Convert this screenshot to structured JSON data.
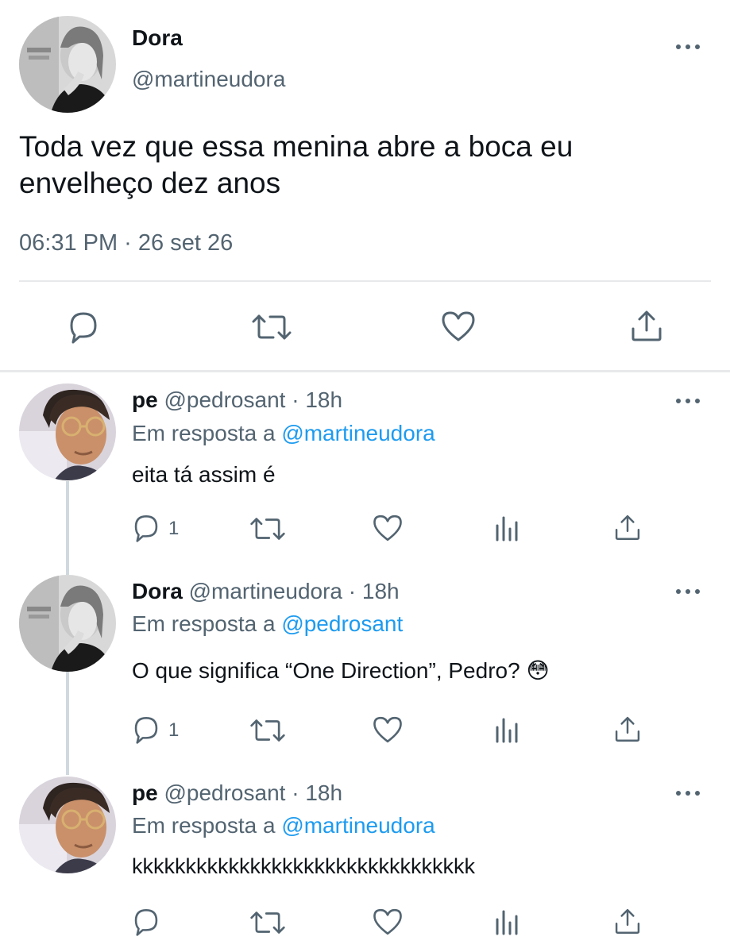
{
  "main_tweet": {
    "name": "Dora",
    "handle": "@martineudora",
    "text_line1": "Toda vez que essa menina abre a boca eu",
    "text_line2": "envelheço dez anos",
    "timestamp": "06:31 PM · 26 set 26",
    "actions": [
      "reply-icon",
      "retweet-icon",
      "like-icon",
      "share-icon"
    ]
  },
  "replies": [
    {
      "name": "pe",
      "handle": "@pedrosant",
      "time": "· 18h",
      "reply_label": "Em resposta a",
      "reply_to": "@martineudora",
      "text": "eita tá assim é",
      "reply_count": "1"
    },
    {
      "name": "Dora",
      "handle": "@martineudora",
      "time": "· 18h",
      "reply_label": "Em resposta a",
      "reply_to": "@pedrosant",
      "text": "O que significa “One Direction”, Pedro? 😳",
      "reply_count": "1"
    },
    {
      "name": "pe",
      "handle": "@pedrosant",
      "time": "· 18h",
      "reply_label": "Em resposta a",
      "reply_to": "@martineudora",
      "text": "kkkkkkkkkkkkkkkkkkkkkkkkkkkkkkkk",
      "reply_count": ""
    }
  ],
  "colors": {
    "text": "#0f1419",
    "secondary": "#536471",
    "link": "#1d9bf0",
    "divider": "#e7e9ea"
  }
}
